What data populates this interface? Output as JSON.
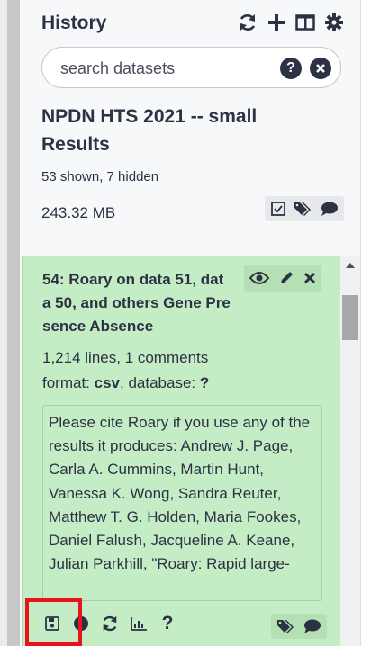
{
  "history": {
    "title": "History",
    "icons": [
      "refresh-icon",
      "plus-icon",
      "columns-icon",
      "gear-icon"
    ],
    "search": {
      "placeholder": "search datasets",
      "value": ""
    },
    "name": "NPDN HTS 2021 -- small Results",
    "counts": "53 shown, 7 hidden",
    "size": "243.32 MB"
  },
  "dataset": {
    "title": "54: Roary on data 51, data 50, and others Gene Presence Absence",
    "lines": "1,214 lines, 1 comments",
    "format_label": "format: ",
    "format": "csv",
    "database_label": ", database: ",
    "database": "?",
    "info": "Please cite Roary if you use any of the results it produces: Andrew J. Page, Carla A. Cummins, Martin Hunt, Vanessa K. Wong, Sandra Reuter, Matthew T. G. Holden, Maria Fookes, Daniel Falush, Jacqueline A. Keane, Julian Parkhill, \"Roary: Rapid large-"
  },
  "colors": {
    "item_bg": "#c5edc5",
    "highlight": "#e8131c",
    "text": "#2c3143"
  }
}
